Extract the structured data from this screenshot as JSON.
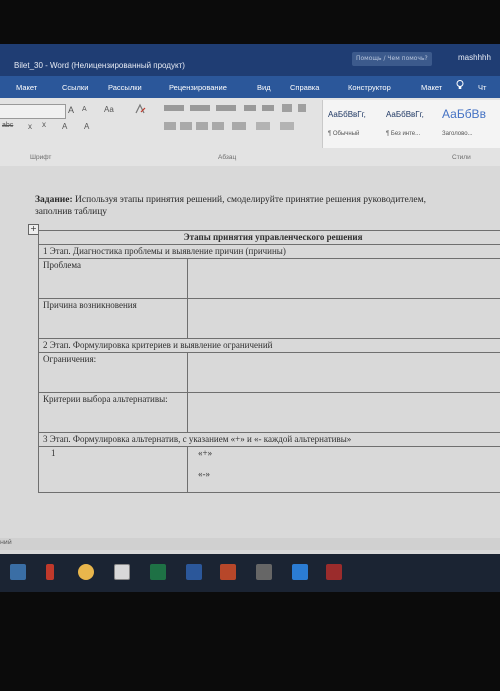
{
  "window": {
    "doc_title": "Bilet_30  -  Word (Нелицензированный продукт)",
    "search_placeholder": "Помощь / Чем помочь?",
    "user": "mashhhh"
  },
  "menu": {
    "tabs": [
      "Макет",
      "Ссылки",
      "Рассылки",
      "Рецензирование",
      "Вид",
      "Справка",
      "Конструктор",
      "Макет",
      "Чт"
    ]
  },
  "ribbon": {
    "font_grow": "A",
    "font_shrink": "A",
    "font_case": "Aa",
    "strike": "abc",
    "sub": "x",
    "sup": "x",
    "highlight": "A",
    "font_color": "A",
    "group_font": "Шрифт",
    "group_paragraph": "Абзац",
    "group_styles": "Стили",
    "styles": [
      {
        "sample": "АаБбВвГг,",
        "name": "¶ Обычный"
      },
      {
        "sample": "АаБбВвГг,",
        "name": "¶ Без инте..."
      },
      {
        "sample": "АаБбВв",
        "name": "Заголово..."
      }
    ]
  },
  "document": {
    "task_label": "Задание:",
    "task_text": " Используя этапы принятия решений, смоделируйте принятие решения руководителем,",
    "task_text2": "заполнив таблицу",
    "table": {
      "header": "Этапы принятия управленческого решения",
      "stage1": "1 Этап. Диагностика проблемы и выявление причин (причины)",
      "problem": "Проблема",
      "cause": "Причина возникновения",
      "stage2": "2 Этап. Формулировка критериев и выявление ограничений",
      "limits": "Ограничения:",
      "criteria": "Критерии выбора альтернативы:",
      "stage3": "3 Этап. Формулировка альтернатив, с указанием «+» и «- каждой альтернативы»",
      "alt_num": "1",
      "plus": "«+»",
      "minus": "«-»"
    }
  },
  "statusbar": {
    "text": "ний"
  },
  "colors": {
    "titlebar": "#1f3d73",
    "menubar": "#2b579a",
    "ribbon": "#e3e3e3",
    "page": "#d9d9d9"
  }
}
